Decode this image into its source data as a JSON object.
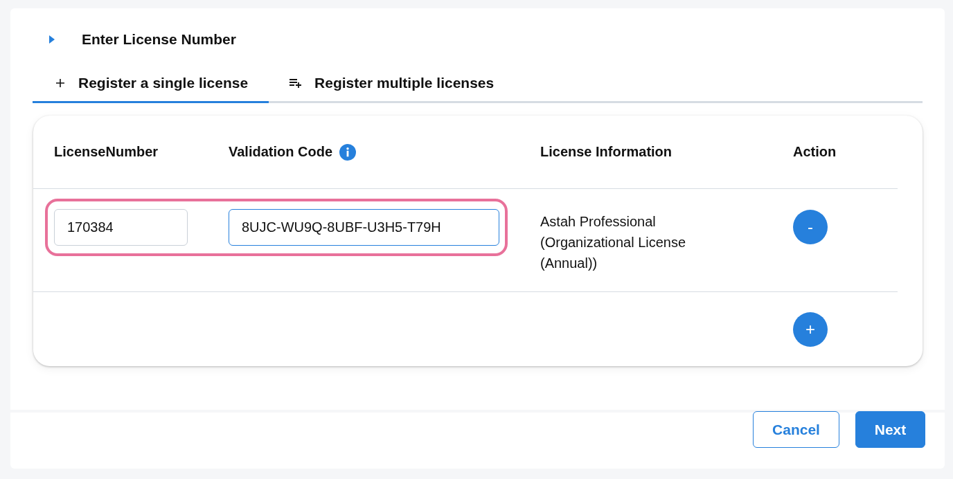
{
  "section": {
    "title": "Enter License Number"
  },
  "tabs": [
    {
      "label": "Register a single license",
      "kind": "plus",
      "selected": true
    },
    {
      "label": "Register multiple licenses",
      "kind": "list-add",
      "selected": false
    }
  ],
  "table": {
    "columns": [
      {
        "label": "LicenseNumber",
        "info": false
      },
      {
        "label": "Validation Code",
        "info": true
      },
      {
        "label": "License Information",
        "info": false
      },
      {
        "label": "Action",
        "info": false
      }
    ],
    "rows": [
      {
        "license_number": {
          "value": "170384",
          "focused": false
        },
        "validation_code": {
          "value": "8UJC-WU9Q-8UBF-U3H5-T79H",
          "focused": true
        },
        "license_information": "Astah Professional (Organizational License (Annual))",
        "action": "-",
        "highlighted": true
      }
    ],
    "add_button": "+"
  },
  "buttons": [
    {
      "label": "Cancel",
      "kind": "secondary"
    },
    {
      "label": "Next",
      "kind": "primary"
    }
  ]
}
